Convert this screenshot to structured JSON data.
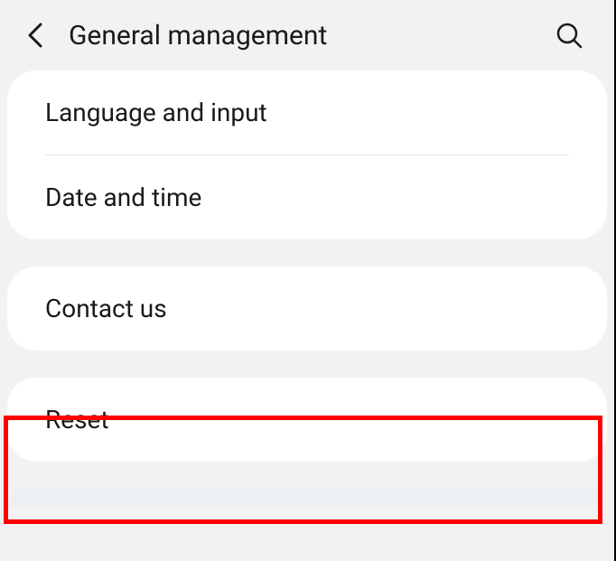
{
  "header": {
    "title": "General management"
  },
  "groups": [
    {
      "items": [
        {
          "label": "Language and input"
        },
        {
          "label": "Date and time"
        }
      ]
    },
    {
      "items": [
        {
          "label": "Contact us"
        }
      ]
    },
    {
      "items": [
        {
          "label": "Reset"
        }
      ],
      "highlighted": true
    }
  ]
}
